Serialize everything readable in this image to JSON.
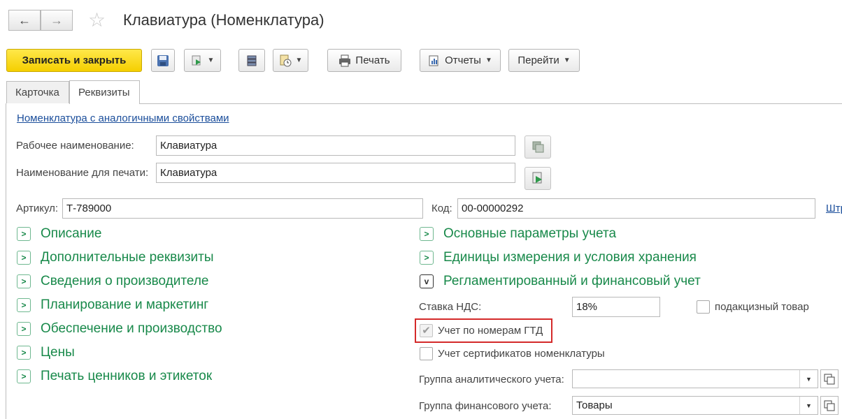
{
  "header": {
    "title": "Клавиатура (Номенклатура)",
    "back_icon": "←",
    "forward_icon": "→",
    "star_icon": "☆"
  },
  "toolbar": {
    "save_close_label": "Записать и закрыть",
    "print_label": "Печать",
    "reports_label": "Отчеты",
    "goto_label": "Перейти"
  },
  "tabs": [
    {
      "label": "Карточка"
    },
    {
      "label": "Реквизиты"
    }
  ],
  "form": {
    "similar_link": "Номенклатура с аналогичными свойствами",
    "working_name_label": "Рабочее наименование:",
    "working_name_value": "Клавиатура",
    "print_name_label": "Наименование для печати:",
    "print_name_value": "Клавиатура",
    "article_label": "Артикул:",
    "article_value": "Т-789000",
    "code_label": "Код:",
    "code_value": "00-00000292",
    "barcode_link": "Штр"
  },
  "left_sections": [
    {
      "label": "Описание"
    },
    {
      "label": "Дополнительные реквизиты"
    },
    {
      "label": "Сведения о производителе"
    },
    {
      "label": "Планирование и маркетинг"
    },
    {
      "label": "Обеспечение и производство"
    },
    {
      "label": "Цены"
    },
    {
      "label": "Печать ценников и этикеток"
    }
  ],
  "right_sections": [
    {
      "label": "Основные параметры учета"
    },
    {
      "label": "Единицы измерения и условия хранения"
    },
    {
      "label": "Регламентированный и финансовый учет"
    }
  ],
  "accounting": {
    "vat_label": "Ставка НДС:",
    "vat_value": "18%",
    "excise_label": "подакцизный товар",
    "gtd_label": "Учет по номерам ГТД",
    "gtd_checked": true,
    "cert_label": "Учет сертификатов номенклатуры",
    "analytic_group_label": "Группа аналитического учета:",
    "analytic_group_value": "",
    "fin_group_label": "Группа финансового учета:",
    "fin_group_value": "Товары"
  },
  "colors": {
    "accent_green": "#18894a",
    "primary_button": "#f5cf00",
    "link_blue": "#1b4e9b",
    "highlight_red": "#d42a2a"
  }
}
